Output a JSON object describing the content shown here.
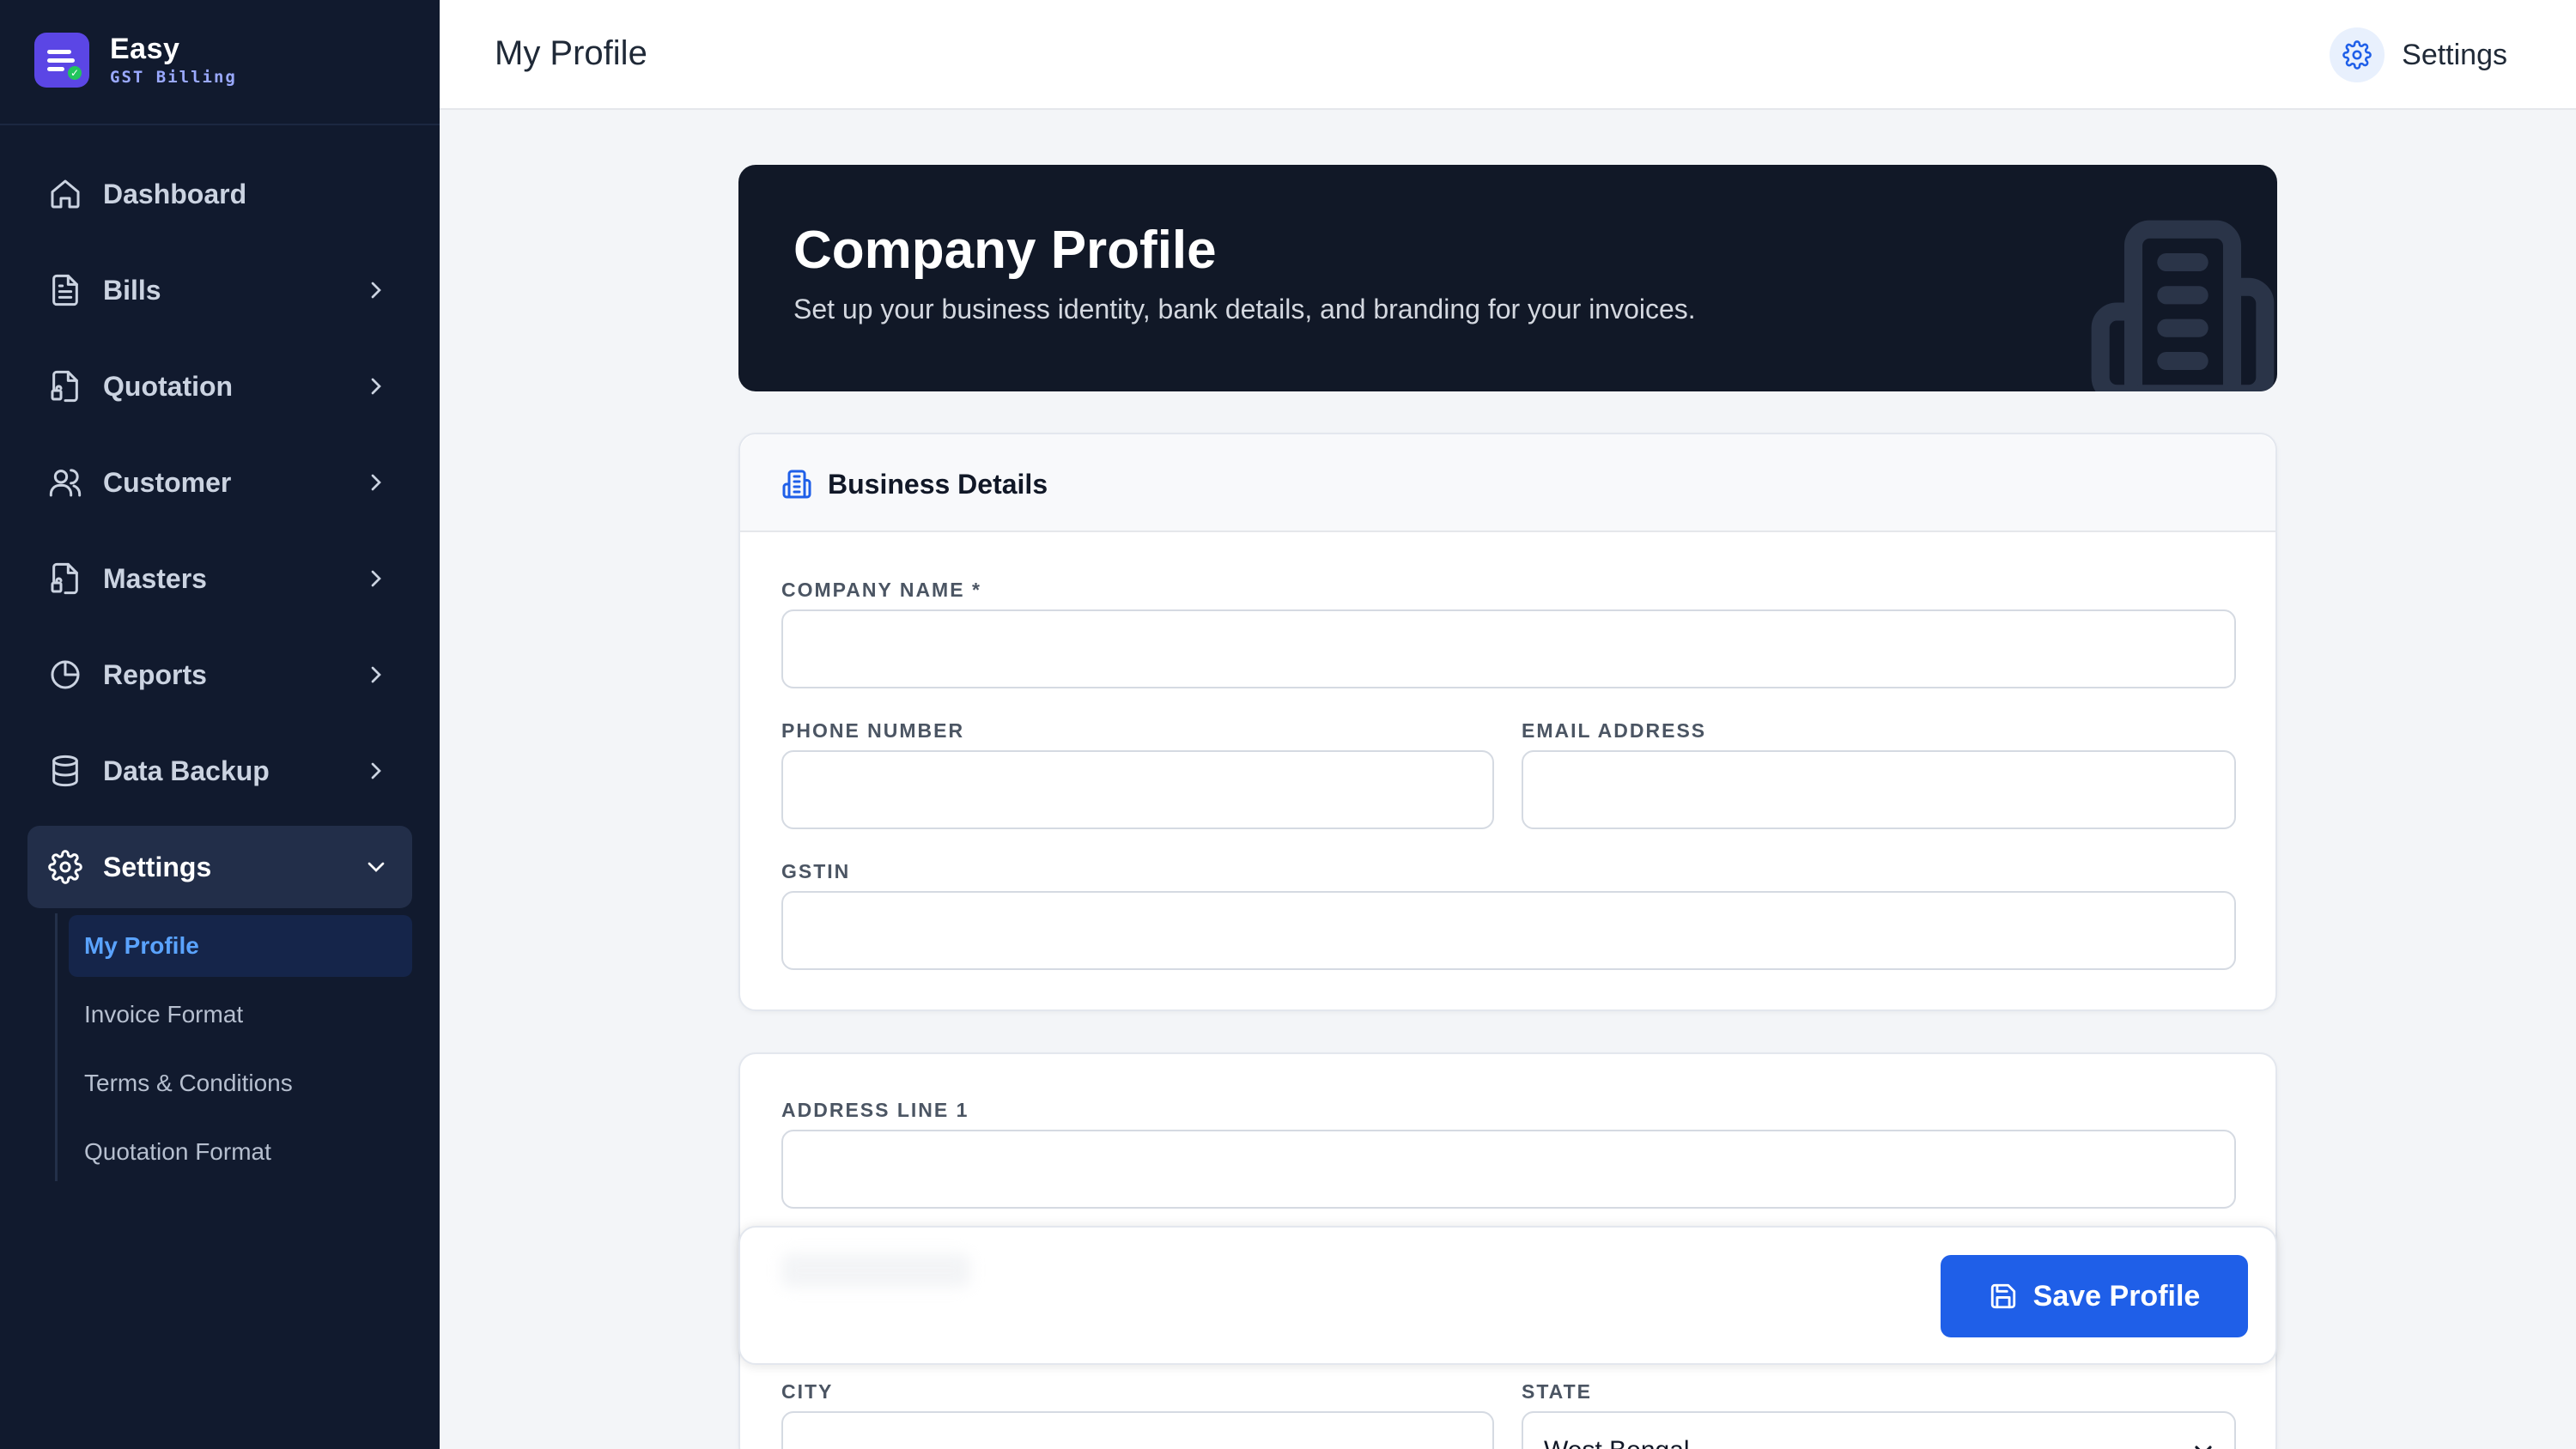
{
  "brand": {
    "name": "Easy",
    "subtitle": "GST Billing"
  },
  "sidebar": {
    "items": [
      {
        "label": "Dashboard",
        "icon": "home-icon"
      },
      {
        "label": "Bills",
        "icon": "file-text-icon"
      },
      {
        "label": "Quotation",
        "icon": "file-signature-icon"
      },
      {
        "label": "Customer",
        "icon": "users-icon"
      },
      {
        "label": "Masters",
        "icon": "file-signature-icon"
      },
      {
        "label": "Reports",
        "icon": "pie-chart-icon"
      },
      {
        "label": "Data Backup",
        "icon": "database-icon"
      },
      {
        "label": "Settings",
        "icon": "gear-icon"
      }
    ],
    "settings_submenu": [
      {
        "label": "My Profile"
      },
      {
        "label": "Invoice Format"
      },
      {
        "label": "Terms & Conditions"
      },
      {
        "label": "Quotation Format"
      }
    ]
  },
  "header": {
    "title": "My Profile",
    "settings_label": "Settings"
  },
  "hero": {
    "title": "Company Profile",
    "subtitle": "Set up your business identity, bank details, and branding for your invoices."
  },
  "business_details": {
    "title": "Business Details",
    "company_name_label": "COMPANY NAME *",
    "company_name_value": "",
    "phone_label": "PHONE NUMBER",
    "phone_value": "",
    "email_label": "EMAIL ADDRESS",
    "email_value": "",
    "gstin_label": "GSTIN",
    "gstin_value": ""
  },
  "address": {
    "line1_label": "ADDRESS LINE 1",
    "line1_value": "",
    "city_label": "CITY",
    "city_value": "",
    "state_label": "STATE",
    "state_value": "West Bengal"
  },
  "actions": {
    "save_label": "Save Profile"
  },
  "colors": {
    "accent": "#1f5fe8",
    "sidebar_bg": "#111a2e",
    "hero_bg": "#111827",
    "active_sub": "#5aa3ff"
  }
}
